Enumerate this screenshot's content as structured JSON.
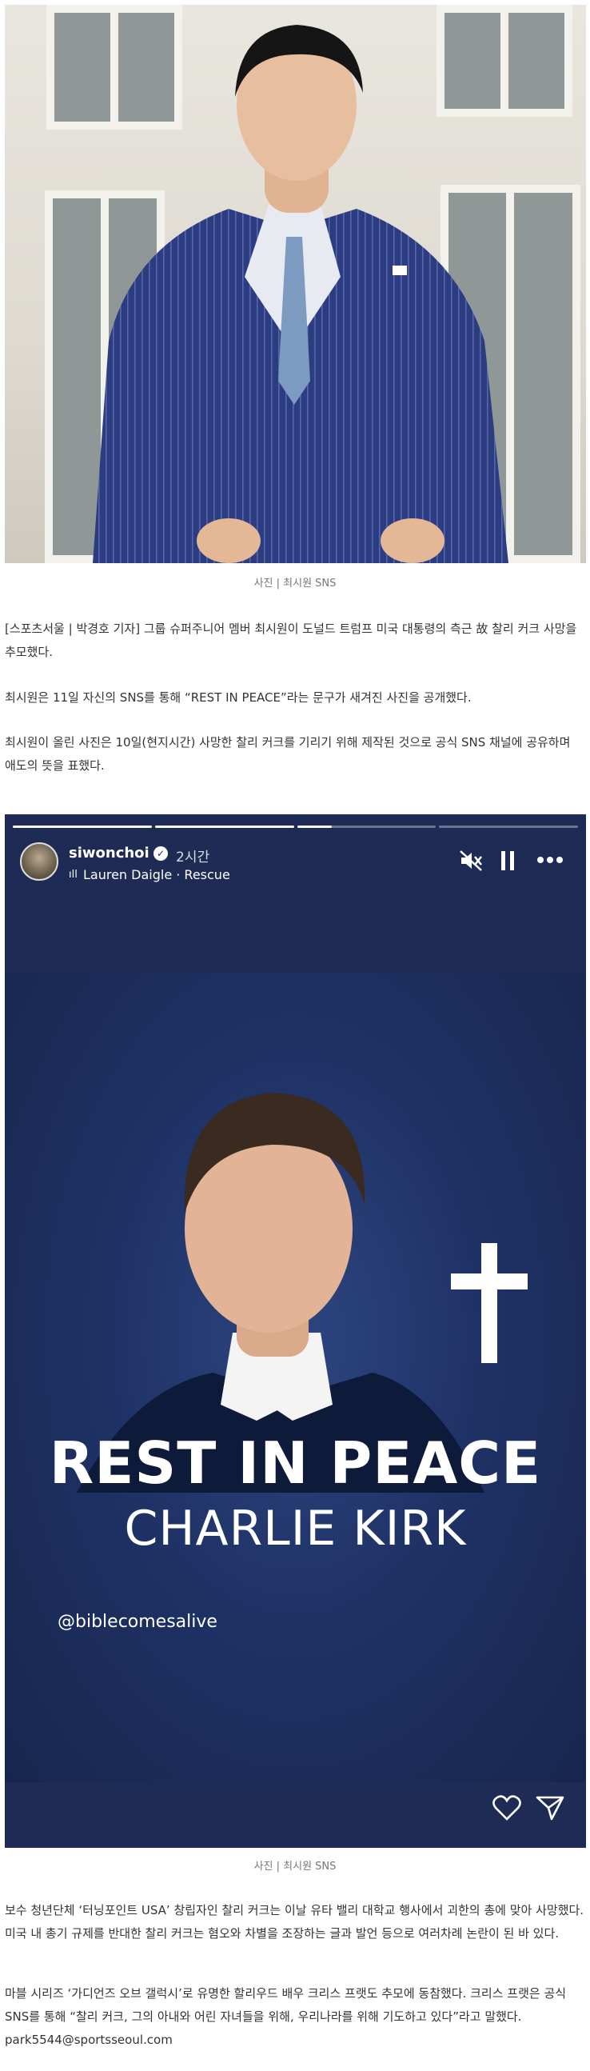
{
  "photo1": {
    "caption": "사진 | 최시원 SNS"
  },
  "article": {
    "paragraphs": [
      "[스포츠서울 | 박경호 기자] 그룹 슈퍼주니어 멤버 최시원이 도널드 트럼프 미국 대통령의 측근 故 찰리 커크 사망을 추모했다.",
      "최시원은 11일 자신의 SNS를 통해 “REST IN PEACE”라는 문구가 새겨진 사진을 공개했다.",
      "최시원이 올린 사진은 10일(현지시간) 사망한 찰리 커크를 기리기 위해 제작된 것으로 공식 SNS 채널에 공유하며 애도의 뜻을 표했다."
    ],
    "paragraphs2": [
      "보수 청년단체 ‘터닝포인트 USA’ 창립자인 찰리 커크는 이날 유타 밸리 대학교 행사에서 괴한의 총에 맞아 사망했다. 미국 내 총기 규제를 반대한 찰리 커크는 혐오와 차별을 조장하는 글과 발언 등으로 여러차례 논란이 된 바 있다.",
      "마블 시리즈 ‘가디언즈 오브 갤럭시’로 유명한 할리우드 배우 크리스 프랫도 추모에 동참했다. 크리스 프랫은 공식 SNS를 통해 “찰리 커크, 그의 아내와 어린 자녀들을 위해, 우리나라를 위해 기도하고 있다”라고 말했다. park5544@sportsseoul.com"
    ]
  },
  "story": {
    "username": "siwonchoi",
    "time": "2시간",
    "music": "Lauren Daigle · Rescue",
    "progress": [
      1,
      1,
      0.25,
      0
    ],
    "rip_line1": "REST IN PEACE",
    "rip_line2": "CHARLIE KIRK",
    "handle": "@biblecomesalive",
    "caption": "사진 | 최시원 SNS",
    "icons": {
      "mute": "mute-icon",
      "pause": "pause-icon",
      "more": "more-icon",
      "like": "heart-icon",
      "share": "send-icon"
    }
  }
}
